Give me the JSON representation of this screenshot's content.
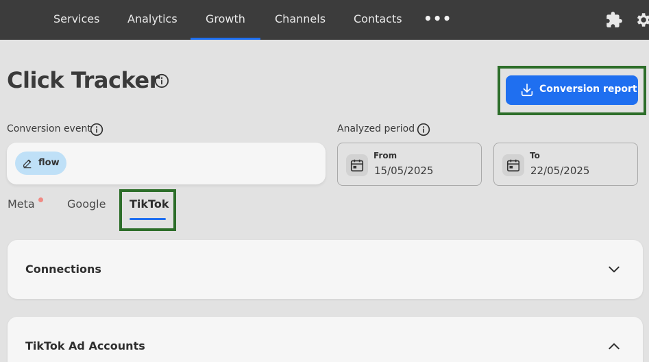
{
  "nav": {
    "items": [
      {
        "label": "Services"
      },
      {
        "label": "Analytics"
      },
      {
        "label": "Growth",
        "active": true
      },
      {
        "label": "Channels"
      },
      {
        "label": "Contacts"
      }
    ],
    "more": "•••",
    "icons": [
      "puzzle-icon",
      "gear-icon"
    ]
  },
  "page": {
    "title": "Click Tracker",
    "report_button": "Conversion report"
  },
  "conversion_event": {
    "label": "Conversion event",
    "chip": "flow"
  },
  "period": {
    "label": "Analyzed period",
    "from_label": "From",
    "from_value": "15/05/2025",
    "to_label": "To",
    "to_value": "22/05/2025"
  },
  "tabs": [
    {
      "label": "Meta",
      "has_badge": true
    },
    {
      "label": "Google"
    },
    {
      "label": "TikTok",
      "active": true
    }
  ],
  "sections": [
    {
      "title": "Connections",
      "state": "collapsed"
    },
    {
      "title": "TikTok Ad Accounts",
      "state": "expanded"
    }
  ],
  "colors": {
    "accent": "#1f6ff0",
    "nav_bg": "#3c3c3c",
    "highlight": "#2d6e2a",
    "chip_bg": "#bfe0f7",
    "badge": "#f08a84"
  }
}
